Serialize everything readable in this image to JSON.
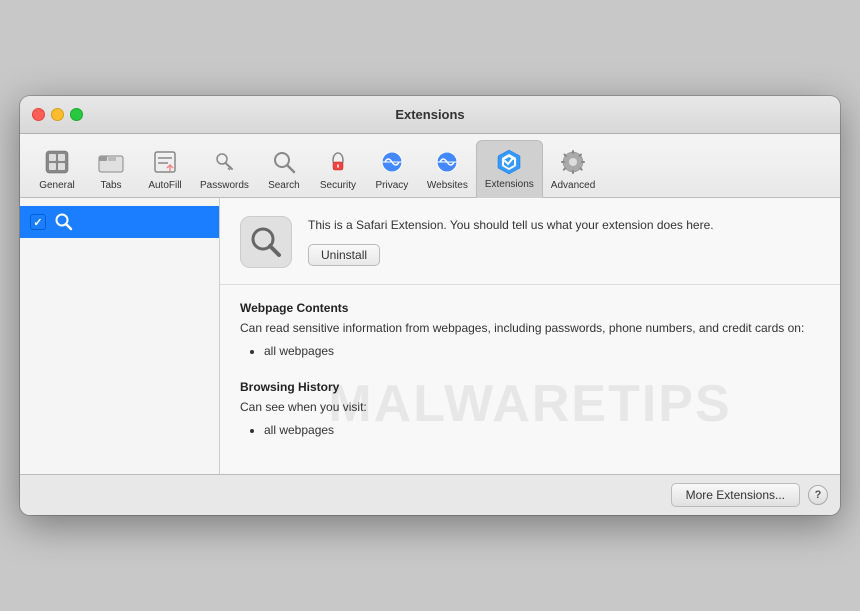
{
  "window": {
    "title": "Extensions"
  },
  "toolbar": {
    "items": [
      {
        "id": "general",
        "label": "General",
        "icon": "general-icon"
      },
      {
        "id": "tabs",
        "label": "Tabs",
        "icon": "tabs-icon"
      },
      {
        "id": "autofill",
        "label": "AutoFill",
        "icon": "autofill-icon"
      },
      {
        "id": "passwords",
        "label": "Passwords",
        "icon": "passwords-icon"
      },
      {
        "id": "search",
        "label": "Search",
        "icon": "search-icon"
      },
      {
        "id": "security",
        "label": "Security",
        "icon": "security-icon"
      },
      {
        "id": "privacy",
        "label": "Privacy",
        "icon": "privacy-icon"
      },
      {
        "id": "websites",
        "label": "Websites",
        "icon": "websites-icon"
      },
      {
        "id": "extensions",
        "label": "Extensions",
        "icon": "extensions-icon"
      },
      {
        "id": "advanced",
        "label": "Advanced",
        "icon": "advanced-icon"
      }
    ],
    "active": "extensions"
  },
  "sidebar": {
    "items": [
      {
        "id": "search-ext",
        "label": "",
        "checked": true
      }
    ]
  },
  "extension": {
    "description": "This is a Safari Extension. You should tell us what your extension does here.",
    "uninstall_label": "Uninstall"
  },
  "permissions": {
    "sections": [
      {
        "title": "Webpage Contents",
        "description": "Can read sensitive information from webpages, including passwords, phone numbers, and credit cards on:",
        "items": [
          "all webpages"
        ]
      },
      {
        "title": "Browsing History",
        "description": "Can see when you visit:",
        "items": [
          "all webpages"
        ]
      }
    ]
  },
  "footer": {
    "more_extensions_label": "More Extensions...",
    "help_label": "?"
  },
  "watermark": {
    "text": "MALWARETIPS"
  }
}
